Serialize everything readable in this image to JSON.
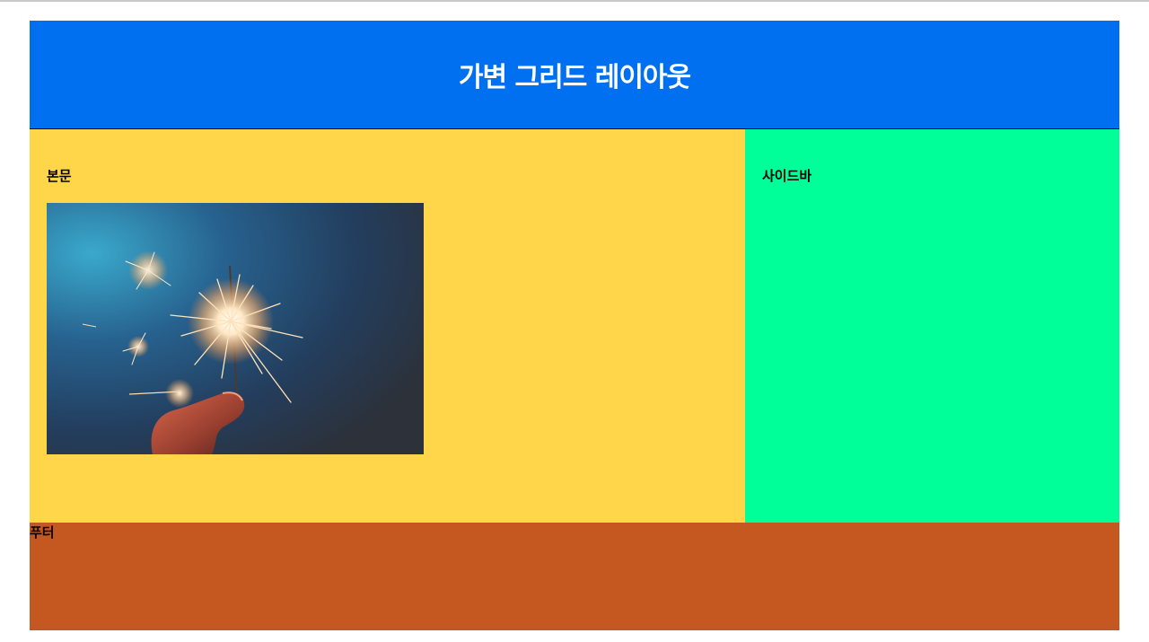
{
  "header": {
    "title": "가변 그리드 레이아웃"
  },
  "main": {
    "heading": "본문",
    "image_icon": "sparkler-photo"
  },
  "sidebar": {
    "heading": "사이드바"
  },
  "footer": {
    "heading": "푸터"
  },
  "colors": {
    "header": "#0070f0",
    "main": "#ffd54a",
    "sidebar": "#00ff99",
    "footer": "#c55720"
  }
}
